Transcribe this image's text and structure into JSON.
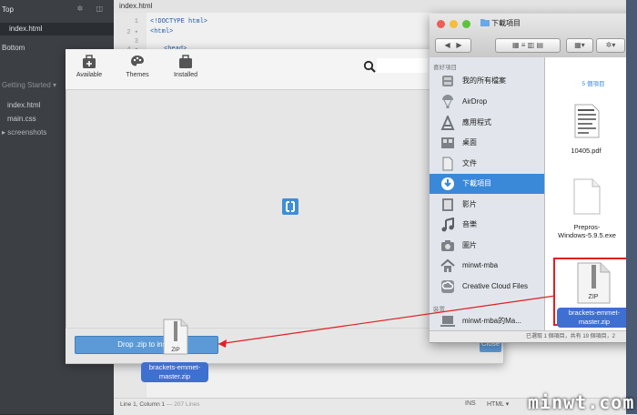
{
  "brackets": {
    "sidebar": {
      "working_files_label": "Top",
      "selected_file": "index.html",
      "bottom_label": "Bottom",
      "project_title": "Getting Started",
      "project_caret": "▾",
      "files": [
        "index.html",
        "main.css",
        "screenshots"
      ]
    },
    "editor": {
      "tab_title": "index.html",
      "lines": [
        {
          "num": "1",
          "code": "<!DOCTYPE html>"
        },
        {
          "num": "2 ▾",
          "code": "<html>"
        },
        {
          "num": "3",
          "code": ""
        },
        {
          "num": "4 ▾",
          "code": "<head>"
        }
      ]
    },
    "statusbar": {
      "position": "Line 1, Column 1",
      "line_count": "— 207 Lines",
      "mode": "INS",
      "language": "HTML ▾"
    }
  },
  "extension_manager": {
    "tabs": [
      {
        "label": "Available"
      },
      {
        "label": "Themes"
      },
      {
        "label": "Installed"
      }
    ],
    "search_placeholder": "",
    "drop_button_label": "Drop .zip to install",
    "close_button_label": "Close",
    "dragged_file_icon_text": "ZIP",
    "dragged_file_label_line1": "brackets-emmet-",
    "dragged_file_label_line2": "master.zip"
  },
  "finder": {
    "title": "下載項目",
    "favorites_header": "喜好項目",
    "devices_header": "裝置",
    "sidebar_items": [
      {
        "label": "我的所有檔案",
        "icon": "all-files-icon"
      },
      {
        "label": "AirDrop",
        "icon": "airdrop-icon"
      },
      {
        "label": "應用程式",
        "icon": "applications-icon"
      },
      {
        "label": "桌面",
        "icon": "desktop-icon"
      },
      {
        "label": "文件",
        "icon": "documents-icon"
      },
      {
        "label": "下載項目",
        "icon": "downloads-icon"
      },
      {
        "label": "影片",
        "icon": "movies-icon"
      },
      {
        "label": "音樂",
        "icon": "music-icon"
      },
      {
        "label": "圖片",
        "icon": "pictures-icon"
      },
      {
        "label": "minwt-mba",
        "icon": "home-icon"
      },
      {
        "label": "Creative Cloud Files",
        "icon": "creative-cloud-icon"
      }
    ],
    "device_item": "minwt-mba的Ma...",
    "top_item_count": "5 個項目",
    "files": [
      {
        "name": "10405.pdf"
      },
      {
        "name_line1": "Prepros-",
        "name_line2": "Windows-5.9.5.exe"
      },
      {
        "icon_text": "ZIP",
        "name_line1": "brackets-emmet-",
        "name_line2": "master.zip"
      }
    ],
    "status_text": "已選取 1 個項目，共有 19 個項目，2",
    "colors": {
      "selection": "#3a88d8",
      "highlight": "#e02020"
    }
  },
  "watermark": "minwt.com"
}
